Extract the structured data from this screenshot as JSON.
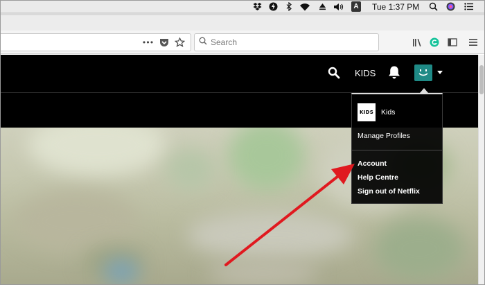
{
  "menubar": {
    "clock": "Tue 1:37 PM",
    "icons": [
      "dropbox-icon",
      "power-icon",
      "bluetooth-icon",
      "wifi-icon",
      "eject-icon",
      "volume-icon",
      "input-source-icon",
      "search-icon",
      "siri-icon",
      "list-icon"
    ],
    "input_source_letter": "A"
  },
  "browser": {
    "search": {
      "placeholder": "Search",
      "value": ""
    },
    "page_actions_glyph": "•••"
  },
  "netflix": {
    "kids_link": "KIDS",
    "profile_color": "#1f8a86",
    "dropdown": {
      "profile_name": "Kids",
      "profile_logo_text": "KIDS",
      "manage_profiles": "Manage Profiles",
      "account": "Account",
      "help": "Help Centre",
      "signout": "Sign out of Netflix"
    }
  },
  "annotation": {
    "arrow_color": "#e0191f"
  }
}
